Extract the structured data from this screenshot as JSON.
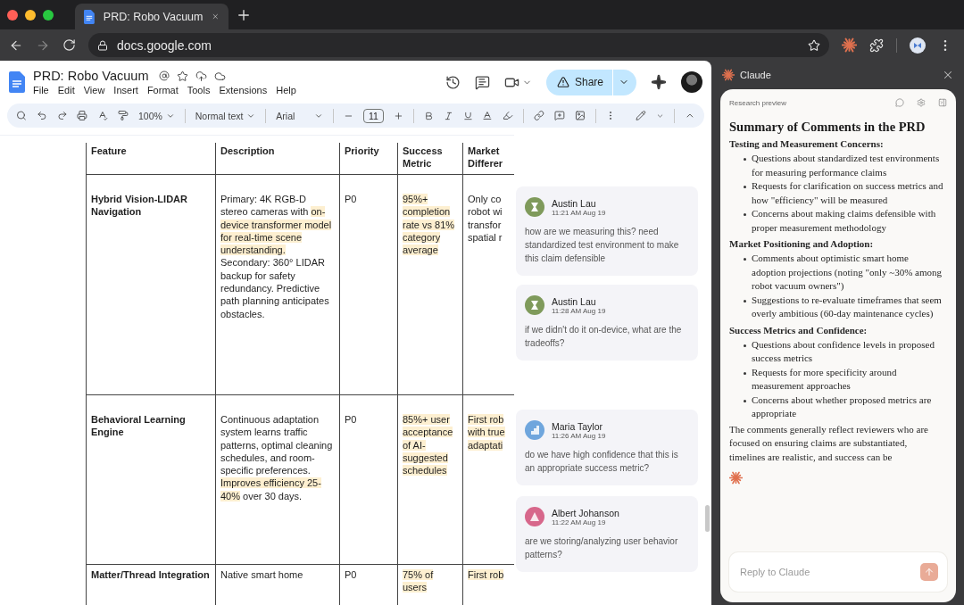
{
  "browser": {
    "tab_title": "PRD: Robo Vacuum",
    "url": "docs.google.com"
  },
  "doc": {
    "title": "PRD: Robo Vacuum",
    "menu": [
      "File",
      "Edit",
      "View",
      "Insert",
      "Format",
      "Tools",
      "Extensions",
      "Help"
    ],
    "share": "Share",
    "toolbar": {
      "zoom": "100%",
      "style": "Normal text",
      "font": "Arial",
      "font_size": "11"
    }
  },
  "table": {
    "columns": [
      "Feature",
      "Description",
      "Priority",
      "Success Metric",
      "Market Differer"
    ],
    "rows": [
      {
        "feature": "Hybrid Vision-LIDAR Navigation",
        "description": [
          {
            "text": "Primary: 4K RGB-D stereo cameras with ",
            "highlighted": false
          },
          {
            "text": "on-device transformer model for real-time scene understanding.",
            "highlighted": true
          },
          {
            "text": " Secondary: 360° LIDAR backup for safety redundancy. Predictive path planning anticipates obstacles.",
            "highlighted": false
          }
        ],
        "priority": "P0",
        "metric": "95%+ completion rate vs 81% category average",
        "metric_highlighted": true,
        "market_lines": [
          "Only co",
          "robot wi",
          "transfor",
          "spatial r"
        ],
        "market_highlighted": false
      },
      {
        "feature": "Behavioral Learning Engine",
        "description": [
          {
            "text": "Continuous adaptation system learns traffic patterns, optimal cleaning schedules, and room-specific preferences. ",
            "highlighted": false
          },
          {
            "text": "Improves efficiency 25-40%",
            "highlighted": true
          },
          {
            "text": " over 30 days.",
            "highlighted": false
          }
        ],
        "priority": "P0",
        "metric": "85%+ user acceptance of AI-suggested schedules",
        "metric_highlighted": true,
        "market_lines": [
          "First rob",
          "with true",
          "adaptati"
        ],
        "market_highlighted": true
      },
      {
        "feature": "Matter/Thread Integration",
        "description": [
          {
            "text": "Native smart home",
            "highlighted": false
          }
        ],
        "priority": "P0",
        "metric": "75% of users",
        "metric_highlighted": true,
        "market_lines": [
          "First rob"
        ],
        "market_highlighted": true
      }
    ]
  },
  "comments": [
    {
      "author": "Austin Lau",
      "time": "11:21 AM Aug 19",
      "text": "how are we measuring this? need standardized test environment to make this claim defensible",
      "color": "#7f9a5b",
      "kind": "hourglass"
    },
    {
      "author": "Austin Lau",
      "time": "11:28 AM Aug 19",
      "text": "if we didn't do it on-device, what are the tradeoffs?",
      "color": "#7f9a5b",
      "kind": "hourglass"
    },
    {
      "author": "Maria Taylor",
      "time": "11:26 AM Aug 19",
      "text": "do we have high confidence that this is an appropriate success metric?",
      "color": "#6fa6dd",
      "kind": "steps"
    },
    {
      "author": "Albert Johanson",
      "time": "11:22 AM Aug 19",
      "text": "are we storing/analyzing user behavior patterns?",
      "color": "#d7678b",
      "kind": "triangle"
    }
  ],
  "claude": {
    "title": "Claude",
    "label": "Research preview",
    "heading": "Summary of Comments in the PRD",
    "sections": [
      {
        "heading": "Testing and Measurement Concerns:",
        "bullets": [
          "Questions about standardized test environments for measuring performance claims",
          "Requests for clarification on success metrics and how \"efficiency\" will be measured",
          "Concerns about making claims defensible with proper measurement methodology"
        ]
      },
      {
        "heading": "Market Positioning and Adoption:",
        "bullets": [
          "Comments about optimistic smart home adoption projections (noting \"only ~30% among robot vacuum owners\")",
          "Suggestions to re-evaluate timeframes that seem overly ambitious (60-day maintenance cycles)"
        ]
      },
      {
        "heading": "Success Metrics and Confidence:",
        "bullets": [
          "Questions about confidence levels in proposed success metrics",
          "Requests for more specificity around measurement approaches",
          "Concerns about whether proposed metrics are appropriate"
        ]
      }
    ],
    "paragraph": "The comments generally reflect reviewers who are focused on ensuring claims are substantiated, timelines are realistic, and success can be",
    "reply_placeholder": "Reply to Claude"
  }
}
